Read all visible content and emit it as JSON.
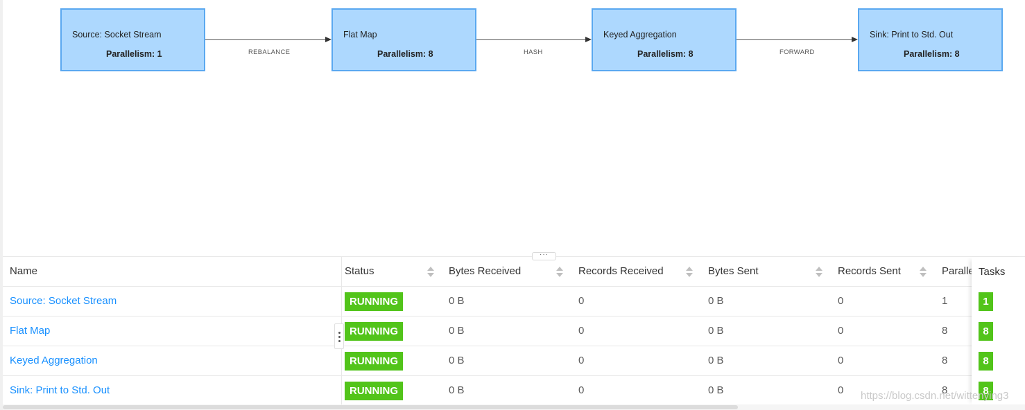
{
  "graph": {
    "nodes": [
      {
        "name": "Source: Socket Stream",
        "parallelism": "Parallelism: 1"
      },
      {
        "name": "Flat Map",
        "parallelism": "Parallelism: 8"
      },
      {
        "name": "Keyed Aggregation",
        "parallelism": "Parallelism: 8"
      },
      {
        "name": "Sink: Print to Std. Out",
        "parallelism": "Parallelism: 8"
      }
    ],
    "edges": [
      {
        "label": "REBALANCE"
      },
      {
        "label": "HASH"
      },
      {
        "label": "FORWARD"
      }
    ]
  },
  "splitter": {
    "label": "···"
  },
  "table": {
    "columns": {
      "name": "Name",
      "status": "Status",
      "bytes_received": "Bytes Received",
      "records_received": "Records Received",
      "bytes_sent": "Bytes Sent",
      "records_sent": "Records Sent",
      "parallelism": "Paralle",
      "tasks": "Tasks"
    },
    "rows": [
      {
        "name": "Source: Socket Stream",
        "status": "RUNNING",
        "bytes_received": "0 B",
        "records_received": "0",
        "bytes_sent": "0 B",
        "records_sent": "0",
        "parallelism": "1",
        "tasks": "1"
      },
      {
        "name": "Flat Map",
        "status": "RUNNING",
        "bytes_received": "0 B",
        "records_received": "0",
        "bytes_sent": "0 B",
        "records_sent": "0",
        "parallelism": "8",
        "tasks": "8"
      },
      {
        "name": "Keyed Aggregation",
        "status": "RUNNING",
        "bytes_received": "0 B",
        "records_received": "0",
        "bytes_sent": "0 B",
        "records_sent": "0",
        "parallelism": "8",
        "tasks": "8"
      },
      {
        "name": "Sink: Print to Std. Out",
        "status": "RUNNING",
        "bytes_received": "0 B",
        "records_received": "0",
        "bytes_sent": "0 B",
        "records_sent": "0",
        "parallelism": "8",
        "tasks": "8"
      }
    ]
  },
  "watermark": "https://blog.csdn.net/wittenying3",
  "colors": {
    "node_fill": "#add8fe",
    "node_border": "#5aa8f0",
    "running": "#52c41a",
    "link": "#1890ff"
  },
  "icons": [
    "arrow-right-icon",
    "sort-icon",
    "column-resize-handle-icon",
    "splitter-handle-icon"
  ]
}
